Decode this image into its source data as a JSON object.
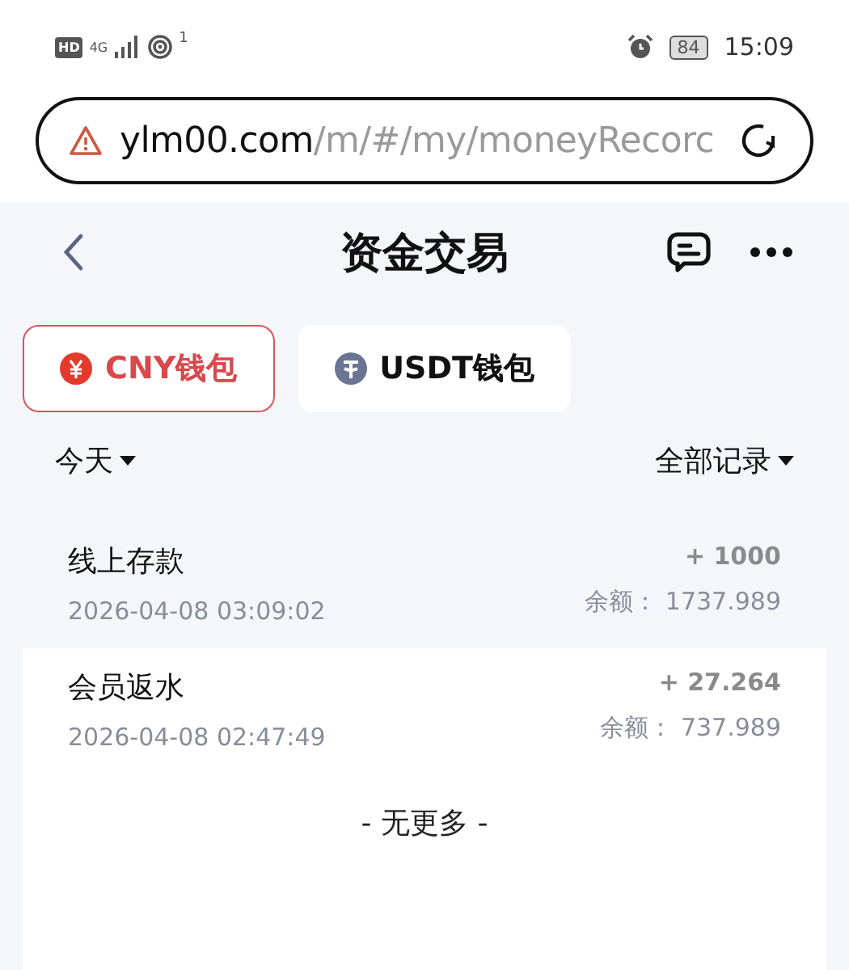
{
  "status_bar": {
    "hd": "HD",
    "network": "4G",
    "hotspot_count": "1",
    "battery": "84",
    "time": "15:09"
  },
  "browser": {
    "url_host": "ylm00.com",
    "url_path": "/m/#/my/moneyRecorc"
  },
  "header": {
    "title": "资金交易"
  },
  "wallet_tabs": [
    {
      "label": "CNY钱包",
      "kind": "cny",
      "selected": true
    },
    {
      "label": "USDT钱包",
      "kind": "usdt",
      "selected": false
    }
  ],
  "filters": {
    "date": "今天",
    "type": "全部记录"
  },
  "records": [
    {
      "title": "线上存款",
      "time": "2026-04-08 03:09:02",
      "amount": "+ 1000",
      "balance_label": "余额：",
      "balance": "1737.989",
      "pressed": true
    },
    {
      "title": "会员返水",
      "time": "2026-04-08 02:47:49",
      "amount": "+ 27.264",
      "balance_label": "余额：",
      "balance": "737.989",
      "pressed": false
    }
  ],
  "end_note": "- 无更多 -"
}
